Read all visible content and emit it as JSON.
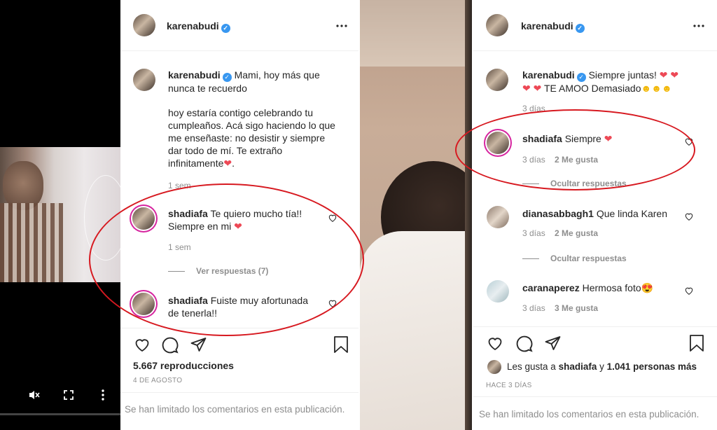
{
  "left": {
    "video": {
      "mute_icon": "muted-speaker-icon",
      "fullscreen_icon": "fullscreen-icon",
      "more_icon": "vertical-dots-icon"
    },
    "header": {
      "username": "karenabudi",
      "more_icon": "horizontal-dots-icon"
    },
    "caption": {
      "username": "karenabudi",
      "text_line1": "Mami, hoy más que",
      "text_line2": "nunca te recuerdo",
      "para": [
        "hoy estaría contigo celebrando tu",
        "cumpleaños. Acá sigo haciendo lo que",
        "me enseñaste: no desistir y siempre",
        "dar todo de mí. Te extraño",
        "infinitamente"
      ],
      "time": "1 sem"
    },
    "comments": [
      {
        "username": "shadiafa",
        "line1": "Te quiero mucho tía!!",
        "line2": "Siempre en mi",
        "time": "1 sem",
        "replies": "Ver respuestas (7)"
      },
      {
        "username": "shadiafa",
        "line1": "Fuiste muy afortunada",
        "line2": "de tenerla!!"
      }
    ],
    "views": "5.667 reproducciones",
    "date": "4 DE AGOSTO",
    "comments_limited": "Se han limitado los comentarios en esta publicación."
  },
  "right": {
    "header": {
      "username": "karenabudi"
    },
    "caption": {
      "username": "karenabudi",
      "text_line1": "Siempre juntas!",
      "text_line2": "TE AMOO Demasiado",
      "time": "3 días"
    },
    "comments": [
      {
        "username": "shadiafa",
        "text": "Siempre",
        "time": "3 días",
        "likes": "2 Me gusta",
        "replies": "Ocultar respuestas"
      },
      {
        "username": "dianasabbagh1",
        "text": "Que linda Karen",
        "time": "3 días",
        "likes": "2 Me gusta",
        "replies": "Ocultar respuestas"
      },
      {
        "username": "caranaperez",
        "text": "Hermosa foto",
        "time": "3 días",
        "likes": "3 Me gusta"
      }
    ],
    "likes_prefix": "Les gusta a",
    "likes_user": "shadiafa",
    "likes_mid": "y",
    "likes_count": "1.041 personas más",
    "date": "HACE 3 DÍAS",
    "comments_limited": "Se han limitado los comentarios en esta publicación."
  },
  "colors": {
    "accent_red": "#ed4956",
    "annotation_red": "#d71920",
    "verified_blue": "#3897f0"
  }
}
